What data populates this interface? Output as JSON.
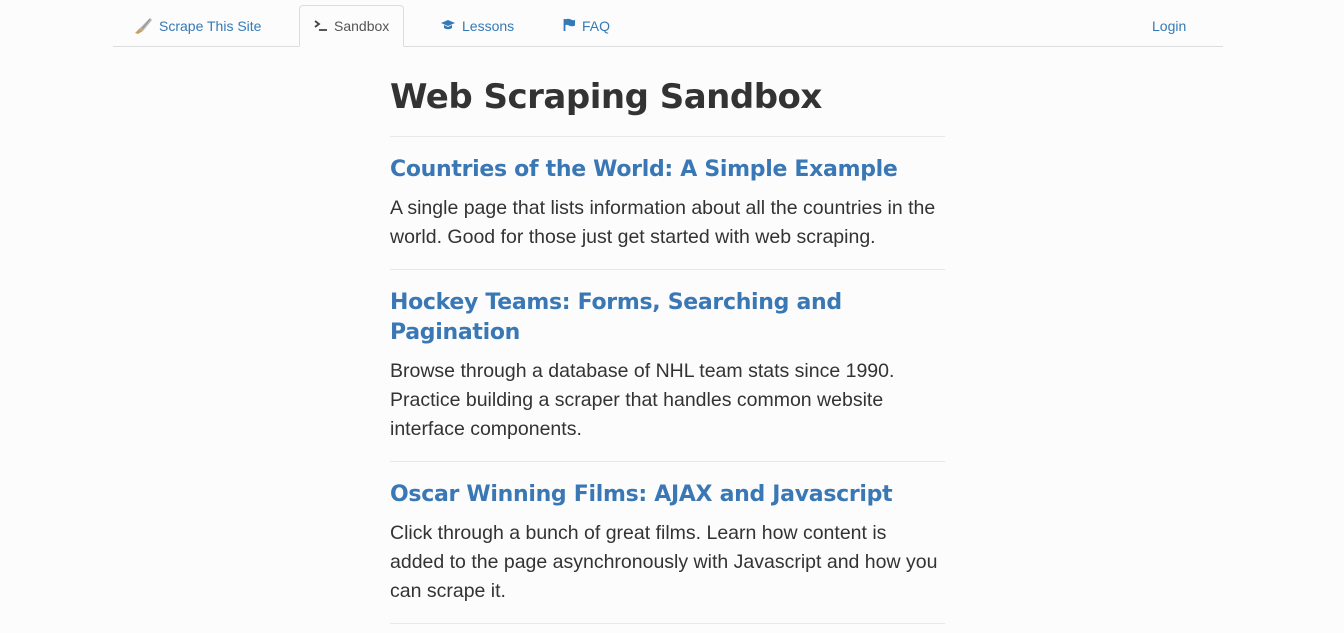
{
  "nav": {
    "brand": {
      "icon": "spatula-icon",
      "label": "Scrape This Site"
    },
    "items": [
      {
        "icon": "terminal-prompt-icon",
        "label": "Sandbox",
        "active": true
      },
      {
        "icon": "graduation-cap-icon",
        "label": "Lessons"
      },
      {
        "icon": "flag-icon",
        "label": "FAQ"
      }
    ],
    "login": "Login"
  },
  "main": {
    "title": "Web Scraping Sandbox",
    "pages": [
      {
        "title": "Countries of the World: A Simple Example",
        "description": "A single page that lists information about all the countries in the world. Good for those just get started with web scraping."
      },
      {
        "title": "Hockey Teams: Forms, Searching and Pagination",
        "description": "Browse through a database of NHL team stats since 1990. Practice building a scraper that handles common website interface components."
      },
      {
        "title": "Oscar Winning Films: AJAX and Javascript",
        "description": "Click through a bunch of great films. Learn how content is added to the page asynchronously with Javascript and how you can scrape it."
      }
    ]
  },
  "colors": {
    "link": "#337ab7",
    "text": "#333333",
    "divider": "#e8e8e8"
  }
}
